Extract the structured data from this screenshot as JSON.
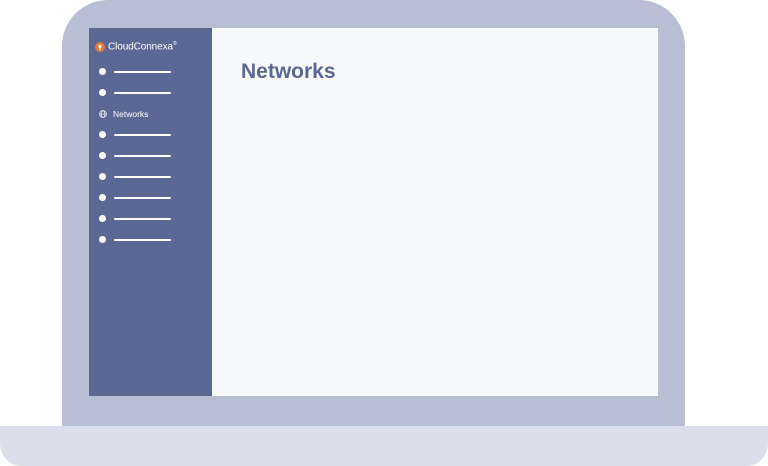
{
  "colors": {
    "sidebar_bg": "#5b6894",
    "content_bg": "#f8f9fb",
    "title_color": "#5b6894",
    "logo_accent": "#e8763a",
    "laptop_frame": "#b8bfd4",
    "laptop_base": "#dcdfeb"
  },
  "brand": {
    "name": "CloudConnexa",
    "trademark": "®",
    "icon": "cloudconnexa-logo-icon"
  },
  "sidebar": {
    "items": [
      {
        "type": "placeholder",
        "icon": "dot-icon"
      },
      {
        "type": "placeholder",
        "icon": "dot-icon"
      },
      {
        "type": "active",
        "icon": "globe-icon",
        "label": "Networks"
      },
      {
        "type": "placeholder",
        "icon": "dot-icon"
      },
      {
        "type": "placeholder",
        "icon": "dot-icon"
      },
      {
        "type": "placeholder",
        "icon": "dot-icon"
      },
      {
        "type": "placeholder",
        "icon": "dot-icon"
      },
      {
        "type": "placeholder",
        "icon": "dot-icon"
      },
      {
        "type": "placeholder",
        "icon": "dot-icon"
      }
    ]
  },
  "main": {
    "title": "Networks"
  }
}
